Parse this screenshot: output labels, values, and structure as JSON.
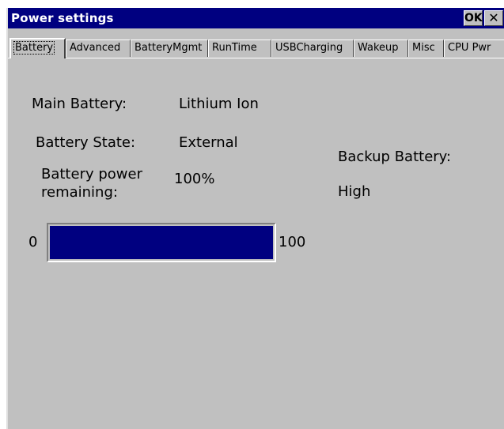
{
  "window": {
    "title": "Power settings",
    "ok_label": "OK",
    "close_label": "✕"
  },
  "tabs": [
    {
      "label": "Battery",
      "active": true
    },
    {
      "label": "Advanced",
      "active": false
    },
    {
      "label": "BatteryMgmt",
      "active": false
    },
    {
      "label": "RunTime",
      "active": false
    },
    {
      "label": "USBCharging",
      "active": false
    },
    {
      "label": "Wakeup",
      "active": false
    },
    {
      "label": "Misc",
      "active": false
    },
    {
      "label": "CPU Pwr",
      "active": false
    }
  ],
  "battery": {
    "main_label": "Main Battery:",
    "main_value": "Lithium Ion",
    "state_label": "Battery State:",
    "state_value": "External",
    "remaining_label_line1": "Battery power",
    "remaining_label_line2": "remaining:",
    "remaining_value": "100%",
    "backup_label": "Backup Battery:",
    "backup_value": "High",
    "progress": {
      "min_label": "0",
      "max_label": "100",
      "percent": 100
    }
  },
  "colors": {
    "titlebar": "#000080",
    "face": "#c0c0c0",
    "progress_fill": "#000080"
  }
}
